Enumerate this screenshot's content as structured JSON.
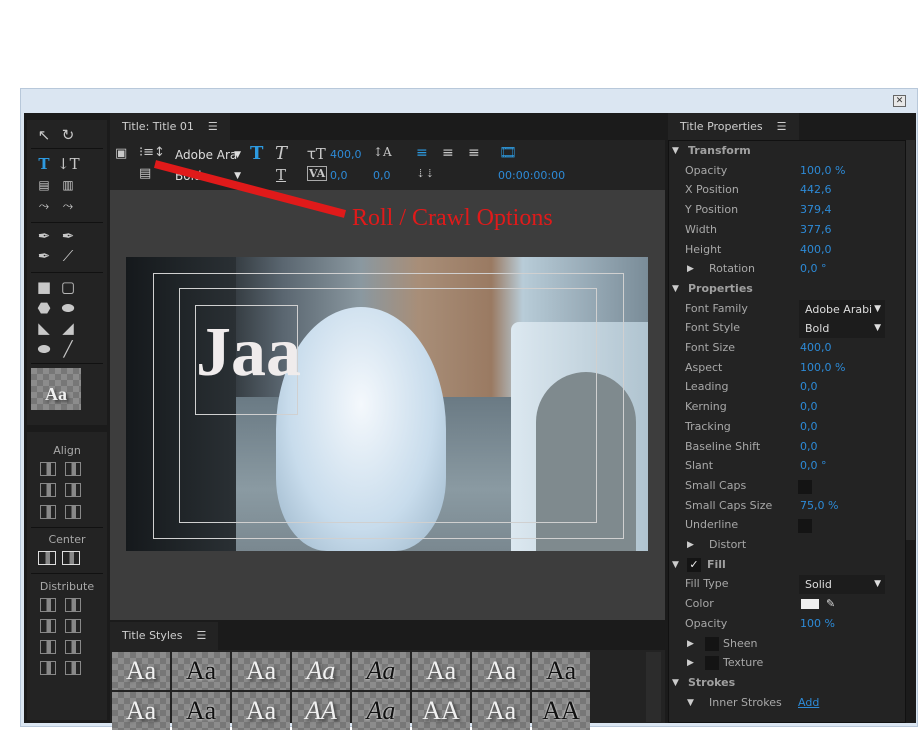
{
  "window": {
    "close_icon": "close-icon"
  },
  "title_panel": {
    "tab": "Title: Title 01",
    "menu": "☰",
    "toolbar": {
      "font_family": "Adobe Ara",
      "font_style": "Bold",
      "font_size": "400,0",
      "kerning": "0,0",
      "leading": "0,0",
      "timecode": "00:00:00:00"
    }
  },
  "canvas": {
    "text": "Jaa"
  },
  "annotation": {
    "text": "Roll / Crawl Options",
    "color": "#e01a1a"
  },
  "align_panel": {
    "align": "Align",
    "center": "Center",
    "distribute": "Distribute"
  },
  "tools": {
    "style_swatch": "Aa"
  },
  "styles_panel": {
    "tab": "Title Styles",
    "menu": "☰",
    "row1": [
      "Aa",
      "Aa",
      "Aa",
      "Aa",
      "Aa",
      "Aa",
      "Aa",
      "Aa"
    ],
    "row2": [
      "Aa",
      "Aa",
      "Aa",
      "AA",
      "Aa",
      "AA",
      "Aa",
      "AA"
    ]
  },
  "properties_panel": {
    "tab": "Title Properties",
    "menu": "☰",
    "rows": [
      {
        "type": "sec",
        "label": "Transform",
        "open": true
      },
      {
        "label": "Opacity",
        "value": "100,0 %"
      },
      {
        "label": "X Position",
        "value": "442,6"
      },
      {
        "label": "Y Position",
        "value": "379,4"
      },
      {
        "label": "Width",
        "value": "377,6"
      },
      {
        "label": "Height",
        "value": "400,0"
      },
      {
        "type": "sub",
        "label": "Rotation",
        "value": "0,0 °"
      },
      {
        "type": "sec",
        "label": "Properties",
        "open": true
      },
      {
        "label": "Font Family",
        "dropdown": "Adobe Arabi"
      },
      {
        "label": "Font Style",
        "dropdown": "Bold"
      },
      {
        "label": "Font Size",
        "value": "400,0"
      },
      {
        "label": "Aspect",
        "value": "100,0 %"
      },
      {
        "label": "Leading",
        "value": "0,0"
      },
      {
        "label": "Kerning",
        "value": "0,0"
      },
      {
        "label": "Tracking",
        "value": "0,0"
      },
      {
        "label": "Baseline Shift",
        "value": "0,0"
      },
      {
        "label": "Slant",
        "value": "0,0 °"
      },
      {
        "label": "Small Caps",
        "checkbox": false
      },
      {
        "label": "Small Caps Size",
        "value": "75,0 %"
      },
      {
        "label": "Underline",
        "checkbox": false
      },
      {
        "type": "sub",
        "label": "Distort"
      },
      {
        "type": "sec",
        "label": "Fill",
        "open": true,
        "checked": true
      },
      {
        "label": "Fill Type",
        "dropdown": "Solid"
      },
      {
        "label": "Color",
        "color": "#eeeeee"
      },
      {
        "label": "Opacity",
        "value": "100 %"
      },
      {
        "type": "subchk",
        "label": "Sheen"
      },
      {
        "type": "subchk",
        "label": "Texture"
      },
      {
        "type": "sec",
        "label": "Strokes",
        "open": true
      },
      {
        "type": "subopen",
        "label": "Inner Strokes",
        "link": "Add"
      }
    ]
  }
}
